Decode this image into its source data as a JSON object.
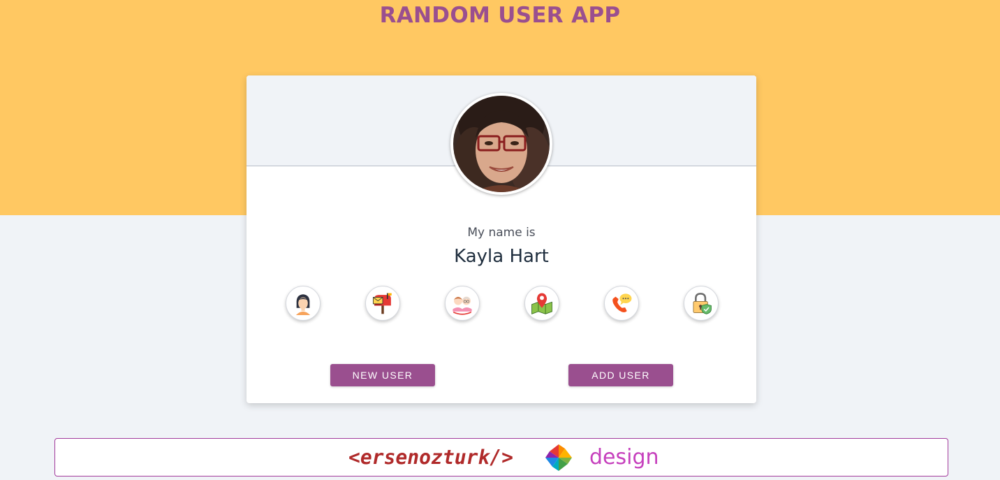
{
  "app": {
    "title": "RANDOM USER APP"
  },
  "card": {
    "intro": "My name is",
    "name": "Kayla Hart",
    "avatar_icon": "user-photo",
    "info_icons": [
      {
        "id": "name",
        "icon": "woman-avatar-icon"
      },
      {
        "id": "email",
        "icon": "mailbox-icon"
      },
      {
        "id": "age",
        "icon": "grandparents-icon"
      },
      {
        "id": "location",
        "icon": "map-pin-icon"
      },
      {
        "id": "phone",
        "icon": "phone-chat-icon"
      },
      {
        "id": "password",
        "icon": "padlock-shield-icon"
      }
    ],
    "buttons": {
      "new_user": "NEW USER",
      "add_user": "ADD USER"
    }
  },
  "footer": {
    "tag": "<ersenozturk/>",
    "logo_icon": "pinwheel-logo",
    "word": "design"
  },
  "colors": {
    "top_band": "#ffc862",
    "accent": "#9a4f8f",
    "page_bg": "#f0f3f7",
    "footer_tag": "#b02a2a",
    "footer_word": "#c640bd"
  }
}
